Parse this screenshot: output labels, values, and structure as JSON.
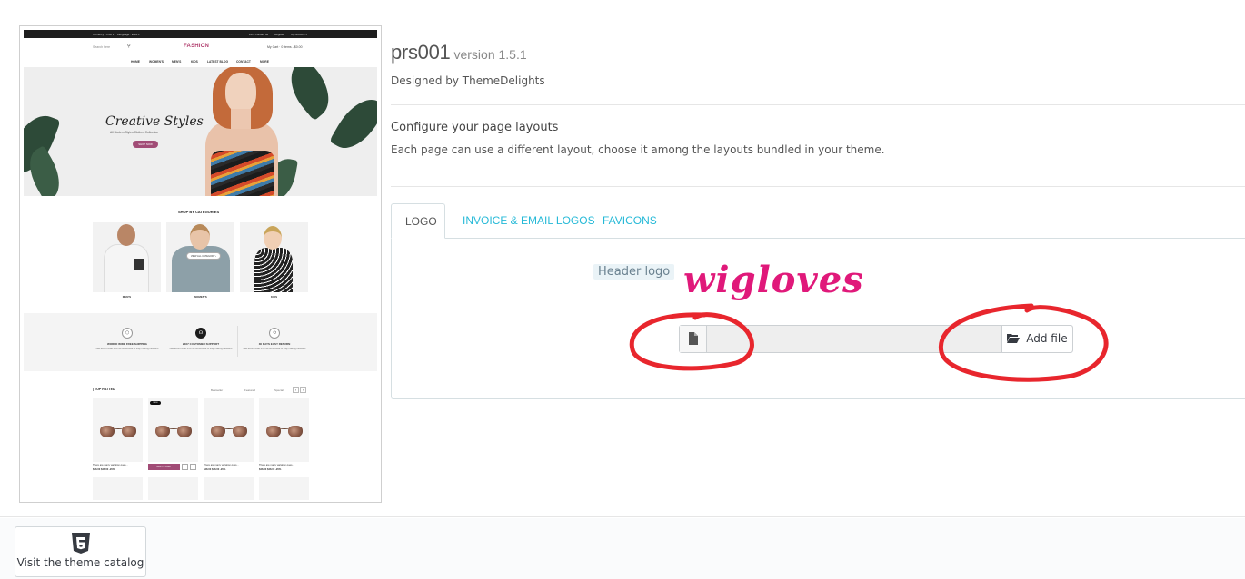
{
  "theme": {
    "name": "prs001",
    "version": "version 1.5.1",
    "designer": "Designed by ThemeDelights"
  },
  "layouts": {
    "title": "Configure your page layouts",
    "description": "Each page can use a different layout, choose it among the layouts bundled in your theme."
  },
  "tabs": [
    {
      "label": "LOGO",
      "active": true
    },
    {
      "label": "INVOICE & EMAIL LOGOS",
      "active": false
    },
    {
      "label": "FAVICONS",
      "active": false
    }
  ],
  "logo_panel": {
    "label": "Header logo",
    "add_file_label": "Add file",
    "file_value": ""
  },
  "watermark": "wigloves",
  "footer": {
    "catalog_label": "Visit the theme catalog"
  },
  "preview": {
    "topbar_currency": "Currency : USD ▾",
    "topbar_language": "Language : ENG ▾",
    "topbar_contact": "24/7 Contact us",
    "topbar_register": "Register",
    "topbar_account": "My Account ▾",
    "search_placeholder": "Search here",
    "logo": "FASHION",
    "cart": "My Cart · 0 items - $0.00",
    "nav": [
      "HOME",
      "WOMEN'S",
      "MEN'S",
      "KIDS",
      "LATEST BLOG",
      "CONTACT",
      "MORE"
    ],
    "hero_title": "Creative Styles",
    "hero_sub": "All Modern Styles Clothes Collection",
    "hero_button": "SHOP NOW",
    "categories_title": "SHOP BY CATEGORIES",
    "categories": [
      "MEN'S",
      "WOMEN'S",
      "KIDS"
    ],
    "category_button": "VIEW ALL CATEGORY ›",
    "services": [
      {
        "title": "WORLD WIDE FREE SHIPPING",
        "text": "Has Ecoro Rate is a not Achievable to stay making beautiful"
      },
      {
        "title": "24X7 CUSTOMER SUPPORT",
        "text": "Has Ecoro Rate is a not Achievable to stay making beautiful"
      },
      {
        "title": "30 DAYS EASY RETURN",
        "text": "Has Ecoro Rate is a not Achievable to stay making beautiful"
      }
    ],
    "top_rated": "| TOP RATTED",
    "product_tabs": [
      "Bestseller",
      "Featured",
      "Special"
    ],
    "new_badge": "NEW",
    "add_to_cart": "ADD TO CART",
    "product_name": "There are many variation gues...",
    "product_price": "$48.00 $48.00 -20%"
  },
  "colors": {
    "accent": "#25b9d7",
    "watermark": "#e0197a",
    "annotation": "#e8262d",
    "preview_brand": "#a14c76"
  }
}
